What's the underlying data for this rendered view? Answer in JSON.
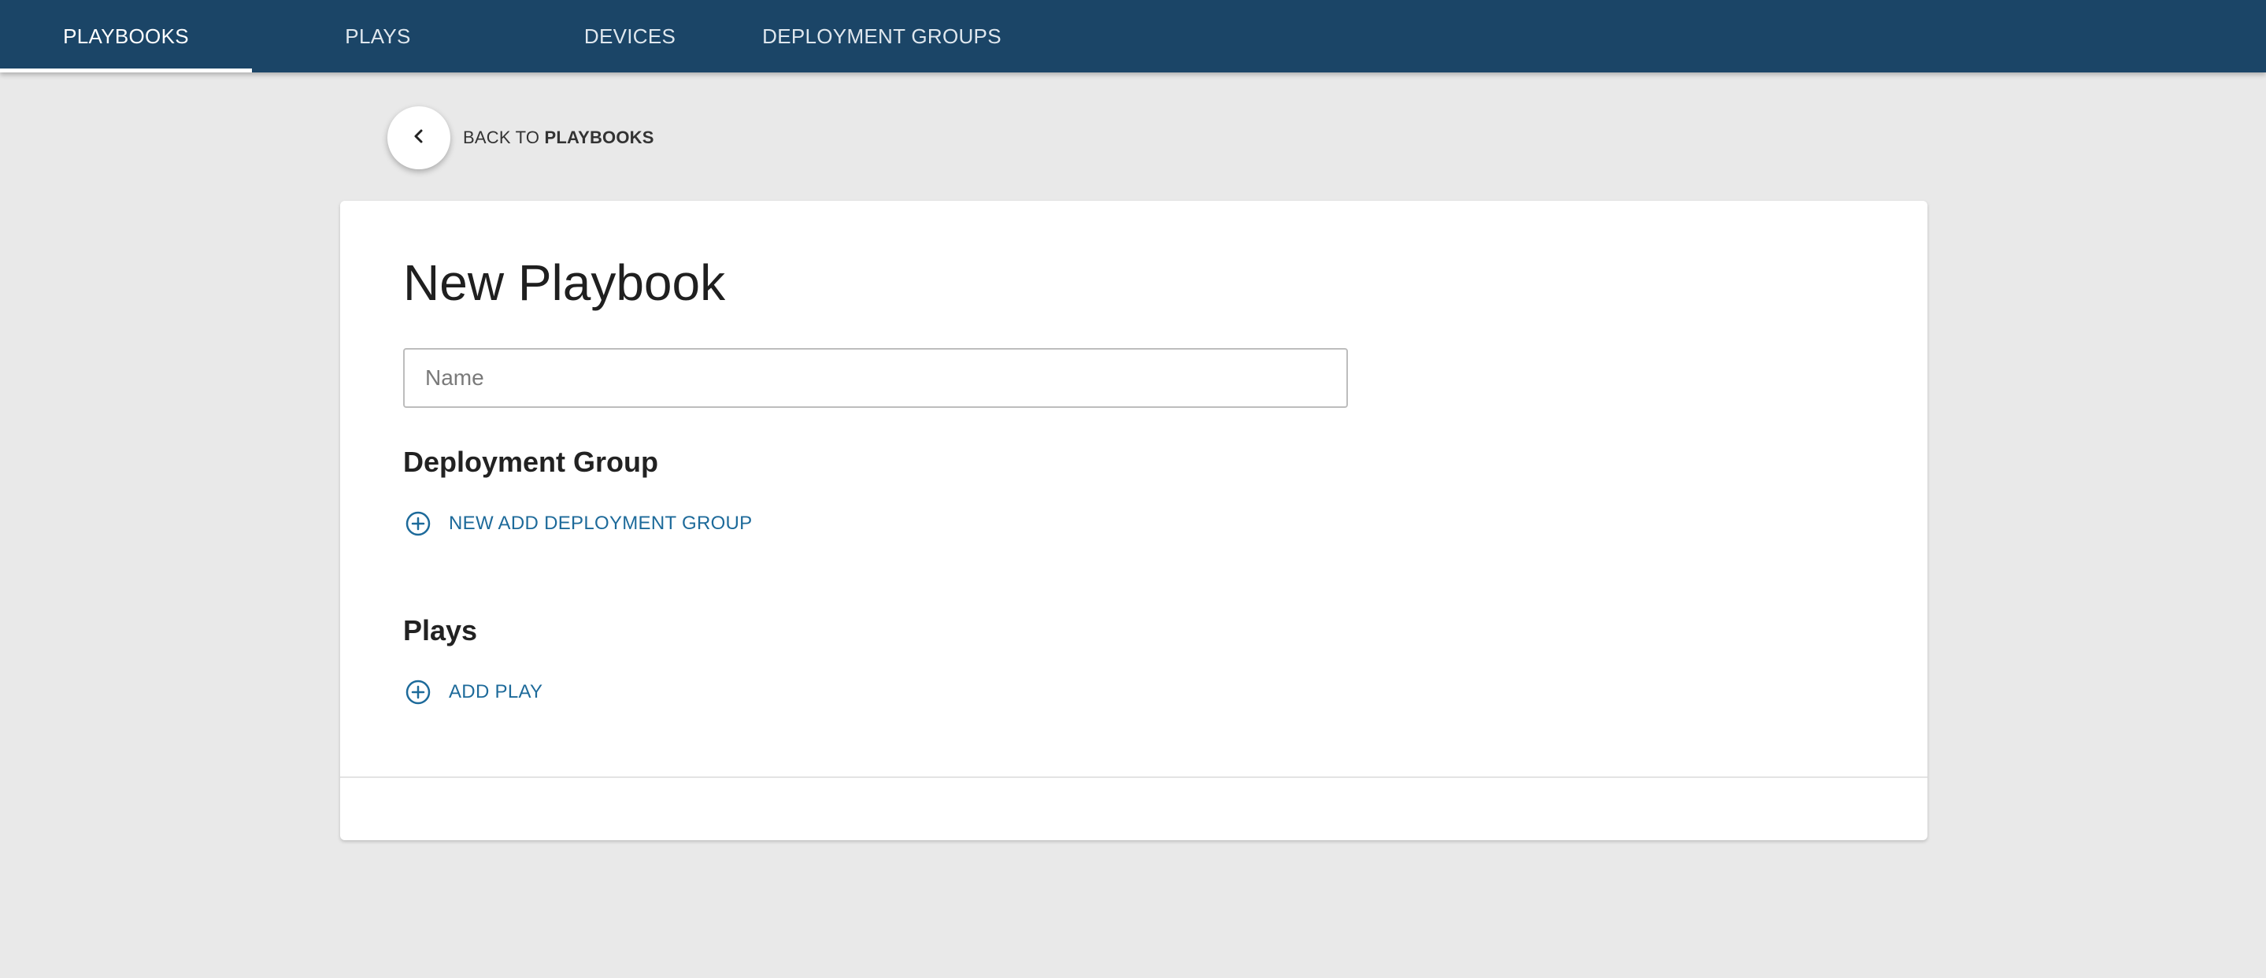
{
  "nav": {
    "tabs": [
      {
        "label": "PLAYBOOKS",
        "active": true
      },
      {
        "label": "PLAYS",
        "active": false
      },
      {
        "label": "DEVICES",
        "active": false
      },
      {
        "label": "DEPLOYMENT GROUPS",
        "active": false
      }
    ]
  },
  "back": {
    "prefix": "BACK TO",
    "target": "PLAYBOOKS",
    "icon": "chevron-left-icon"
  },
  "form": {
    "title": "New Playbook",
    "name_placeholder": "Name",
    "name_value": "",
    "deployment_group": {
      "heading": "Deployment Group",
      "add_label": "NEW ADD DEPLOYMENT GROUP",
      "icon": "plus-circle-icon"
    },
    "plays": {
      "heading": "Plays",
      "add_label": "ADD PLAY",
      "icon": "plus-circle-icon"
    }
  },
  "colors": {
    "topbar": "#1b4567",
    "accent": "#1d6a9a",
    "background": "#e9e9e9"
  }
}
